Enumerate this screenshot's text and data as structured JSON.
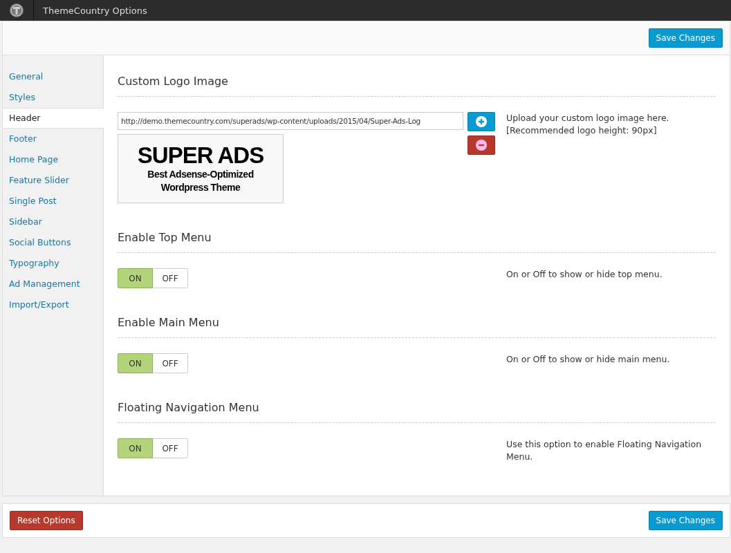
{
  "topbar": {
    "title": "ThemeCountry Options"
  },
  "header": {
    "save_button": "Save Changes"
  },
  "sidebar": {
    "items": [
      {
        "label": "General",
        "selected": false
      },
      {
        "label": "Styles",
        "selected": false
      },
      {
        "label": "Header",
        "selected": true
      },
      {
        "label": "Footer",
        "selected": false
      },
      {
        "label": "Home Page",
        "selected": false
      },
      {
        "label": "Feature Slider",
        "selected": false
      },
      {
        "label": "Single Post",
        "selected": false
      },
      {
        "label": "Sidebar",
        "selected": false
      },
      {
        "label": "Social Buttons",
        "selected": false
      },
      {
        "label": "Typography",
        "selected": false
      },
      {
        "label": "Ad Management",
        "selected": false
      },
      {
        "label": "Import/Export",
        "selected": false
      }
    ]
  },
  "sections": [
    {
      "kind": "logo",
      "title": "Custom Logo Image",
      "value": "http://demo.themecountry.com/superads/wp-content/uploads/2015/04/Super-Ads-Log",
      "preview": {
        "title": "SUPER ADS",
        "tagline": [
          "Best Adsense-Optimized",
          "Wordpress Theme"
        ]
      },
      "description": [
        "Upload your custom logo image here.",
        "[Recommended logo height: 90px]"
      ]
    },
    {
      "kind": "toggle",
      "title": "Enable Top Menu",
      "on": true,
      "on_label": "ON",
      "off_label": "OFF",
      "description": [
        "On or Off to show or hide top menu."
      ]
    },
    {
      "kind": "toggle",
      "title": "Enable Main Menu",
      "on": true,
      "on_label": "ON",
      "off_label": "OFF",
      "description": [
        "On or Off to show or hide main menu."
      ]
    },
    {
      "kind": "toggle",
      "title": "Floating Navigation Menu",
      "on": true,
      "on_label": "ON",
      "off_label": "OFF",
      "description": [
        "Use this option to enable Floating Navigation Menu."
      ]
    }
  ],
  "footer": {
    "reset_button": "Reset Options",
    "save_button": "Save Changes"
  }
}
